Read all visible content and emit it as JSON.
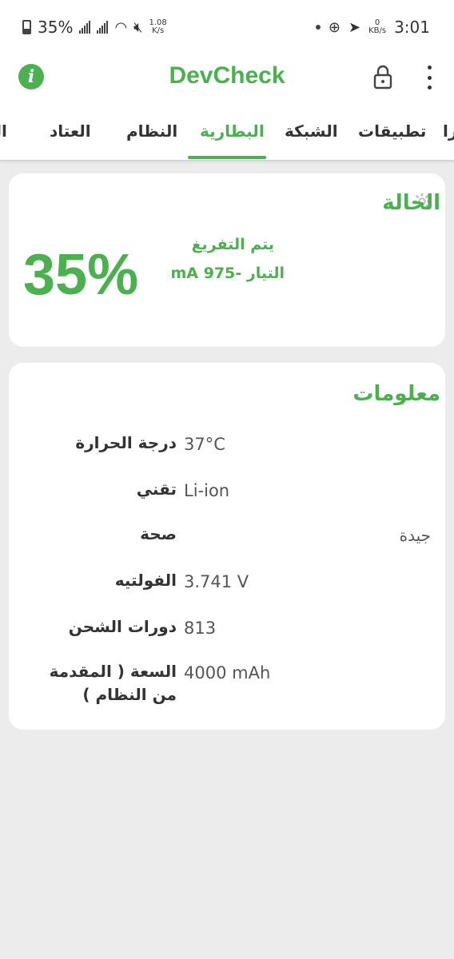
{
  "status_bar": {
    "battery_percent": "35%",
    "net_speed_value": "1.08",
    "net_speed_unit": "K/s",
    "kb_value": "0",
    "kb_unit": "KB/s",
    "time": "3:01"
  },
  "app_bar": {
    "title": "DevCheck"
  },
  "tabs": [
    {
      "label": "را"
    },
    {
      "label": "تطبيقات"
    },
    {
      "label": "الشبكة"
    },
    {
      "label": "البطارية",
      "active": true
    },
    {
      "label": "النظام"
    },
    {
      "label": "العتاد"
    },
    {
      "label": "الر"
    }
  ],
  "status_card": {
    "title": "الحالة",
    "percent": "35%",
    "state": "يتم التفريغ",
    "current": "التيار -975 mA"
  },
  "info_card": {
    "title": "معلومات",
    "rows": [
      {
        "label": "درجة الحرارة",
        "value": "37°C"
      },
      {
        "label": "تقني",
        "value": "Li-ion"
      },
      {
        "label": "صحة",
        "value": "جيدة"
      },
      {
        "label": "الفولتيه",
        "value": "3.741 V"
      },
      {
        "label": "دورات الشحن",
        "value": "813"
      },
      {
        "label": "السعة ( المقدمة من النظام )",
        "value": "4000 mAh"
      }
    ]
  },
  "colors": {
    "accent": "#4caf50",
    "background": "#ececec",
    "card": "#ffffff"
  }
}
